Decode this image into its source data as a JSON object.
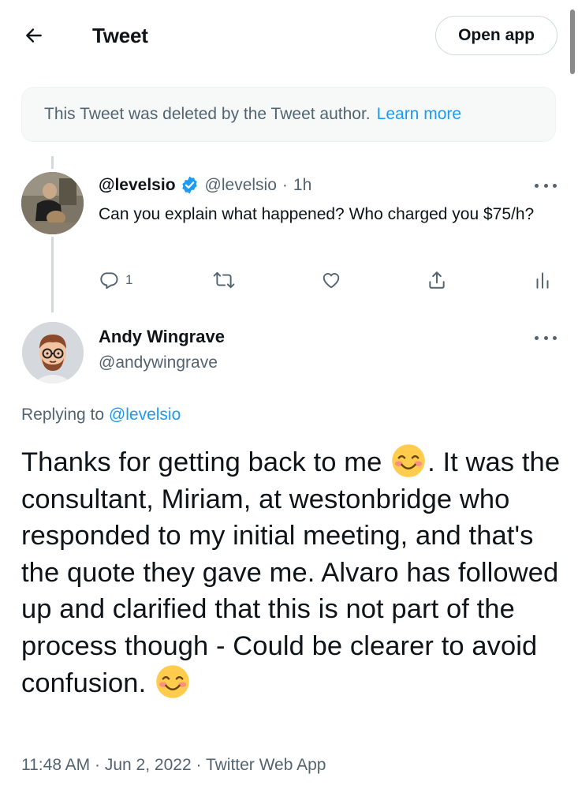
{
  "header": {
    "title": "Tweet",
    "open_app": "Open app"
  },
  "notice": {
    "text": "This Tweet was deleted by the Tweet author.",
    "link": "Learn more"
  },
  "parent_tweet": {
    "display_name": "@levelsio",
    "handle": "@levelsio",
    "separator": "·",
    "time": "1h",
    "text": "Can you explain what happened? Who charged you $75/h?",
    "reply_count": "1",
    "verified": true
  },
  "main_tweet": {
    "display_name": "Andy Wingrave",
    "handle": "@andywingrave",
    "replying_prefix": "Replying to",
    "replying_to": "@levelsio",
    "text_part1": "Thanks for getting back to me",
    "text_part2": ". It was the consultant, Miriam, at westonbridge who responded to my initial meeting, and that's the quote they gave me. Alvaro has followed up and clarified that this is not part of the process though - Could be clearer to avoid confusion.",
    "time": "11:48 AM",
    "date": "Jun 2, 2022",
    "source": "Twitter Web App",
    "separator": "·"
  },
  "icons": {
    "back": "arrow-left-icon",
    "verified": "verified-badge-icon",
    "more": "more-horizontal-icon",
    "reply": "reply-icon",
    "retweet": "retweet-icon",
    "like": "heart-icon",
    "share": "share-icon",
    "analytics": "analytics-icon",
    "emoji": "smiling-face-emoji"
  },
  "colors": {
    "accent": "#1d9bf0",
    "text_primary": "#0f1419",
    "text_secondary": "#536471",
    "border": "#cfd9de",
    "notice_bg": "#f7f9f9"
  }
}
